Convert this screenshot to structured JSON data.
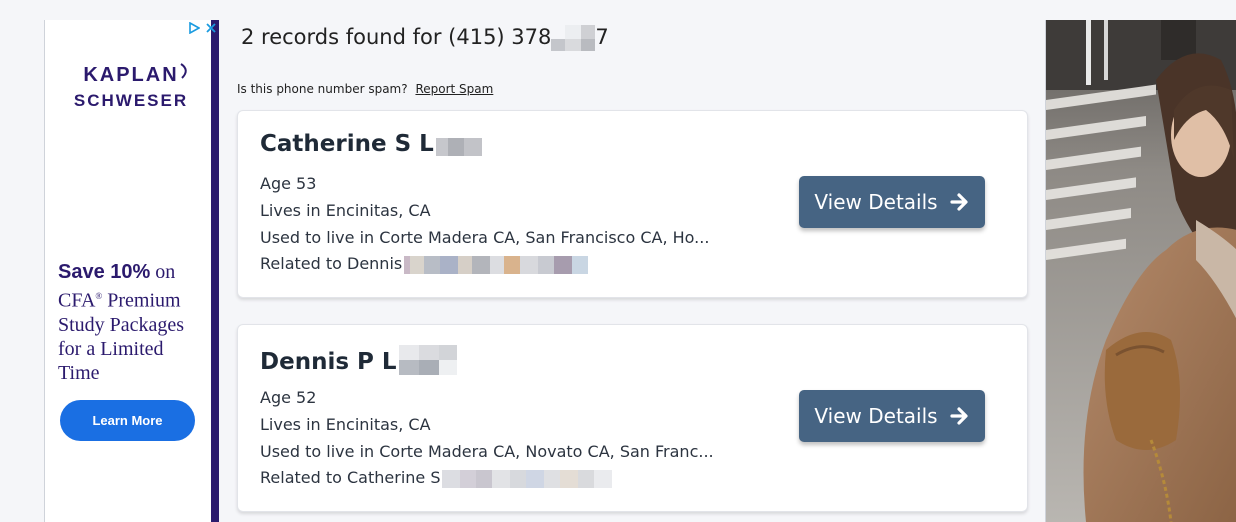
{
  "results": {
    "title": "2 records found for (415) 378",
    "title_tail": "7",
    "spam_question": "Is this phone number spam?",
    "report_spam_label": "Report Spam"
  },
  "records": [
    {
      "name": "Catherine S L",
      "age": "Age 53",
      "lives_in": "Lives in Encinitas, CA",
      "used_to_live": "Used to live in Corte Madera CA, San Francisco CA, Ho...",
      "related_to": "Related to Dennis",
      "button_label": "View Details"
    },
    {
      "name": "Dennis P L",
      "age": "Age 52",
      "lives_in": "Lives in Encinitas, CA",
      "used_to_live": "Used to live in Corte Madera CA, Novato CA, San Franc...",
      "related_to": "Related to Catherine S",
      "button_label": "View Details"
    }
  ],
  "left_ad": {
    "brand_top": "KAPLAN",
    "brand_bottom": "SCHWESER",
    "headline_bold": "Save 10%",
    "headline_rest_1": " on",
    "headline_rest_2": "CFA",
    "headline_reg": "®",
    "headline_rest_3": " Premium Study Packages for a Limited Time",
    "cta_label": "Learn More",
    "brand_color": "#2b1a6d",
    "cta_color": "#1a6fe3"
  },
  "colors": {
    "button_bg": "#466483",
    "page_bg": "#f5f6f9"
  }
}
